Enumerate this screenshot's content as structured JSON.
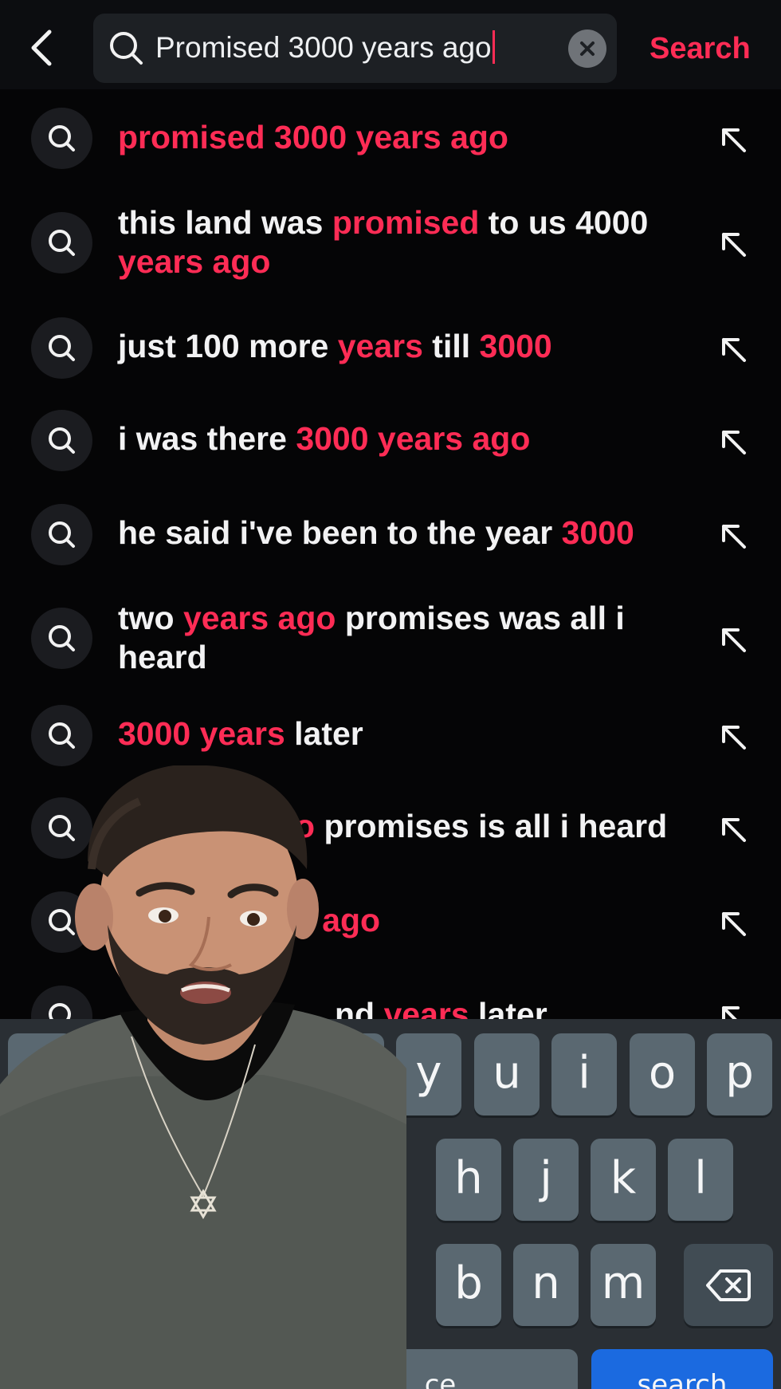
{
  "search": {
    "query": "Promised 3000 years ago",
    "submit_label": "Search"
  },
  "suggestions": [
    {
      "parts": [
        {
          "t": "promised 3000 years ago",
          "h": true
        }
      ]
    },
    {
      "parts": [
        {
          "t": "this land was ",
          "h": false
        },
        {
          "t": "promised",
          "h": true
        },
        {
          "t": " to us 4000 ",
          "h": false
        },
        {
          "t": "years ago",
          "h": true
        }
      ]
    },
    {
      "parts": [
        {
          "t": "just 100 more ",
          "h": false
        },
        {
          "t": "years",
          "h": true
        },
        {
          "t": " till ",
          "h": false
        },
        {
          "t": "3000",
          "h": true
        }
      ]
    },
    {
      "parts": [
        {
          "t": "i was there ",
          "h": false
        },
        {
          "t": "3000 years ago",
          "h": true
        }
      ]
    },
    {
      "parts": [
        {
          "t": "he said i've been to the year ",
          "h": false
        },
        {
          "t": "3000",
          "h": true
        }
      ]
    },
    {
      "parts": [
        {
          "t": "two ",
          "h": false
        },
        {
          "t": "years ago",
          "h": true
        },
        {
          "t": " promises was all i heard",
          "h": false
        }
      ]
    },
    {
      "parts": [
        {
          "t": "3000 years",
          "h": true
        },
        {
          "t": " later",
          "h": false
        }
      ]
    },
    {
      "parts": [
        {
          "t": "o",
          "h": true
        },
        {
          "t": " promises is all i heard",
          "h": false
        }
      ]
    },
    {
      "parts": [
        {
          "t": "s ago",
          "h": true
        }
      ]
    },
    {
      "parts": [
        {
          "t": "nd ",
          "h": false
        },
        {
          "t": "years",
          "h": true
        },
        {
          "t": " later",
          "h": false
        }
      ]
    }
  ],
  "keyboard": {
    "row1": [
      "q",
      "w",
      "",
      "",
      "t",
      "y",
      "u",
      "i",
      "o",
      "p"
    ],
    "row2": [
      "h",
      "j",
      "k",
      "l"
    ],
    "row3": [
      "b",
      "n",
      "m"
    ],
    "space_label": "ce",
    "action_label": "search",
    "backspace_icon": "backspace-icon"
  },
  "colors": {
    "accent": "#fe2c55",
    "background": "#050506",
    "key": "#5a6871",
    "keyboard_bg": "#2a2f34"
  }
}
